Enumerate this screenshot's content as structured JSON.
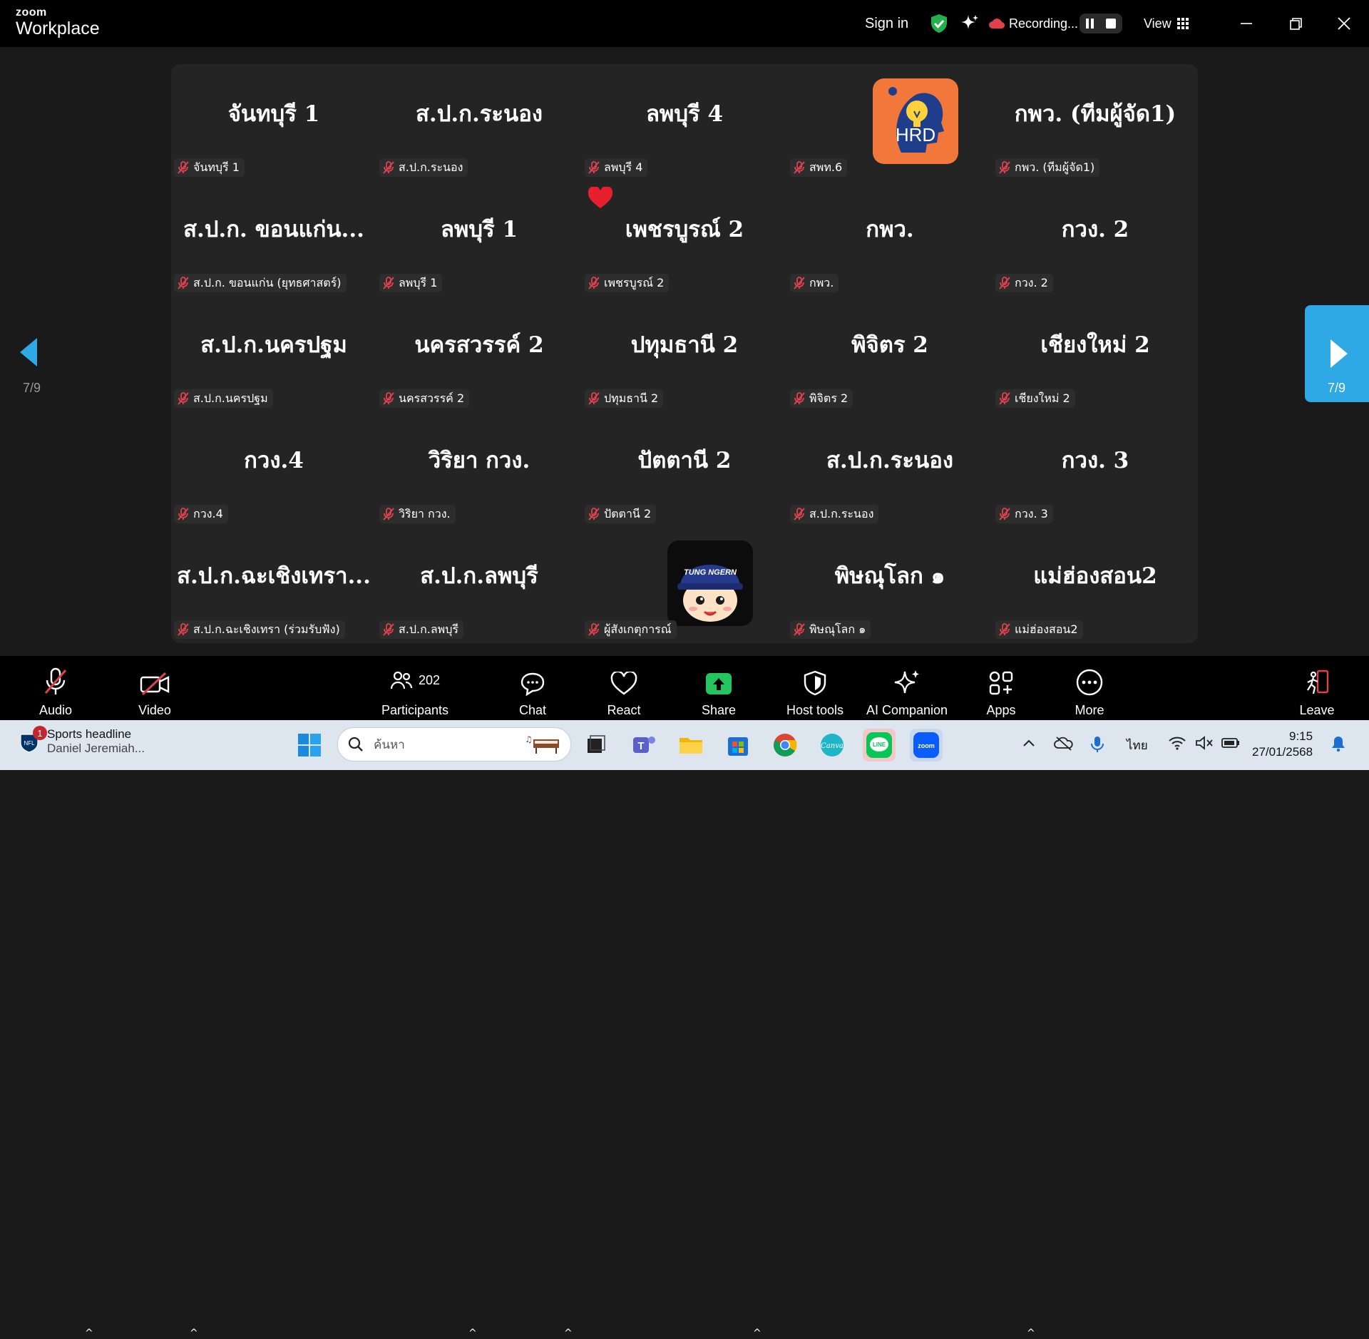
{
  "app": {
    "brand_small": "zoom",
    "brand_big": "Workplace"
  },
  "topbar": {
    "sign_in": "Sign in",
    "recording": "Recording...",
    "view": "View"
  },
  "tiles": [
    {
      "name": "จันทบุรี 1",
      "label": "จันทบุรี 1"
    },
    {
      "name": "ส.ป.ก.ระนอง",
      "label": "ส.ป.ก.ระนอง"
    },
    {
      "name": "ลพบุรี 4",
      "label": "ลพบุรี 4"
    },
    {
      "name": "",
      "label": "สพท.6",
      "avatar": "hrd-logo"
    },
    {
      "name": "กพว. (ทีมผู้จัด1)",
      "label": "กพว. (ทีมผู้จัด1)"
    },
    {
      "name": "ส.ป.ก. ขอนแก่น...",
      "label": "ส.ป.ก. ขอนแก่น (ยุทธศาสตร์)"
    },
    {
      "name": "ลพบุรี 1",
      "label": "ลพบุรี 1"
    },
    {
      "name": "เพชรบูรณ์ 2",
      "label": "เพชรบูรณ์ 2"
    },
    {
      "name": "กพว.",
      "label": "กพว."
    },
    {
      "name": "กวง. 2",
      "label": "กวง. 2"
    },
    {
      "name": "ส.ป.ก.นครปฐม",
      "label": "ส.ป.ก.นครปฐม"
    },
    {
      "name": "นครสวรรค์ 2",
      "label": "นครสวรรค์ 2"
    },
    {
      "name": "ปทุมธานี 2",
      "label": "ปทุมธานี 2"
    },
    {
      "name": "พิจิตร 2",
      "label": "พิจิตร 2"
    },
    {
      "name": "เชียงใหม่ 2",
      "label": "เชียงใหม่ 2"
    },
    {
      "name": "กวง.4",
      "label": "กวง.4"
    },
    {
      "name": "วิริยา กวง.",
      "label": "วิริยา กวง."
    },
    {
      "name": "ปัตตานี 2",
      "label": "ปัตตานี 2"
    },
    {
      "name": "ส.ป.ก.ระนอง",
      "label": "ส.ป.ก.ระนอง"
    },
    {
      "name": "กวง. 3",
      "label": "กวง. 3"
    },
    {
      "name": "ส.ป.ก.ฉะเชิงเทรา...",
      "label": "ส.ป.ก.ฉะเชิงเทรา (ร่วมรับฟัง)"
    },
    {
      "name": "ส.ป.ก.ลพบุรี",
      "label": "ส.ป.ก.ลพบุรี"
    },
    {
      "name": "",
      "label": "ผู้สังเกตุการณ์",
      "avatar": "tung-ngern-cartoon"
    },
    {
      "name": "พิษณุโลก ๑",
      "label": "พิษณุโลก ๑"
    },
    {
      "name": "แม่ฮ่องสอน2",
      "label": "แม่ฮ่องสอน2"
    }
  ],
  "avatars": {
    "hrd_text": "HRD",
    "tung_text": "TUNG NGERN"
  },
  "pagination": {
    "left": "7/9",
    "right": "7/9"
  },
  "toolbar": {
    "audio": "Audio",
    "video": "Video",
    "participants": "Participants",
    "participants_count": "202",
    "chat": "Chat",
    "react": "React",
    "share": "Share",
    "host_tools": "Host tools",
    "ai_companion": "AI Companion",
    "apps": "Apps",
    "more": "More",
    "leave": "Leave"
  },
  "taskbar": {
    "news_title": "Sports headline",
    "news_sub": "Daniel Jeremiah...",
    "news_badge": "1",
    "search_placeholder": "ค้นหา",
    "lang": "ไทย",
    "time": "9:15",
    "date": "27/01/2568"
  },
  "colors": {
    "accent": "#2fa8e6",
    "muted_red": "#e0424b",
    "rec_green": "#22b14c"
  }
}
